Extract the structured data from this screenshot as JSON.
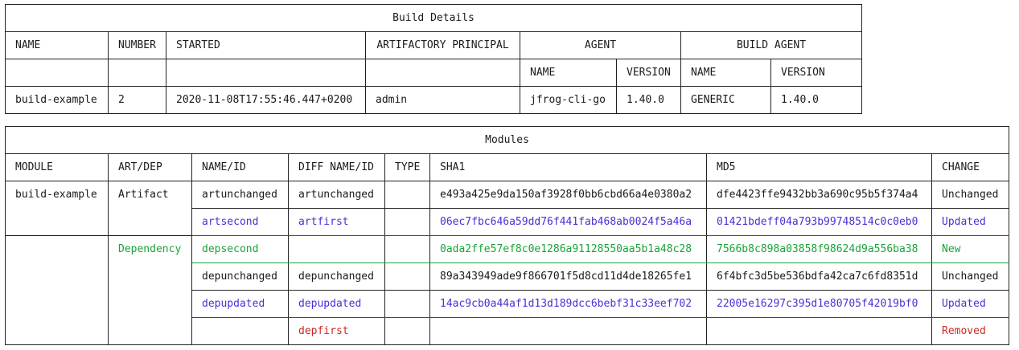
{
  "build": {
    "title": "Build Details",
    "headers": {
      "name": "NAME",
      "number": "NUMBER",
      "started": "STARTED",
      "principal": "ARTIFACTORY PRINCIPAL",
      "agent": "AGENT",
      "build_agent": "BUILD AGENT",
      "agent_name": "NAME",
      "agent_version": "VERSION",
      "build_agent_name": "NAME",
      "build_agent_version": "VERSION"
    },
    "row": {
      "name": "build-example",
      "number": "2",
      "started": "2020-11-08T17:55:46.447+0200",
      "principal": "admin",
      "agent_name": "jfrog-cli-go",
      "agent_version": "1.40.0",
      "build_agent_name": "GENERIC",
      "build_agent_version": "1.40.0"
    }
  },
  "modules": {
    "title": "Modules",
    "headers": {
      "module": "MODULE",
      "artdep": "ART/DEP",
      "nameid": "NAME/ID",
      "diffnameid": "DIFF NAME/ID",
      "type": "TYPE",
      "sha1": "SHA1",
      "md5": "MD5",
      "change": "CHANGE"
    },
    "module_name": "build-example",
    "artifact_label": "Artifact",
    "dependency_label": "Dependency",
    "rows": [
      {
        "name": "artunchanged",
        "diff": "artunchanged",
        "type": "",
        "sha1": "e493a425e9da150af3928f0bb6cbd66a4e0380a2",
        "md5": "dfe4423ffe9432bb3a690c95b5f374a4",
        "change": "Unchanged"
      },
      {
        "name": "artsecond",
        "diff": "artfirst",
        "type": "",
        "sha1": "06ec7fbc646a59dd76f441fab468ab0024f5a46a",
        "md5": "01421bdeff04a793b99748514c0c0eb0",
        "change": "Updated"
      },
      {
        "name": "depsecond",
        "diff": "",
        "type": "",
        "sha1": "0ada2ffe57ef8c0e1286a91128550aa5b1a48c28",
        "md5": "7566b8c898a03858f98624d9a556ba38",
        "change": "New"
      },
      {
        "name": "depunchanged",
        "diff": "depunchanged",
        "type": "",
        "sha1": "89a343949ade9f866701f5d8cd11d4de18265fe1",
        "md5": "6f4bfc3d5be536bdfa42ca7c6fd8351d",
        "change": "Unchanged"
      },
      {
        "name": "depupdated",
        "diff": "depupdated",
        "type": "",
        "sha1": "14ac9cb0a44af1d13d189dcc6bebf31c33eef702",
        "md5": "22005e16297c395d1e80705f42019bf0",
        "change": "Updated"
      },
      {
        "name": "",
        "diff": "depfirst",
        "type": "",
        "sha1": "",
        "md5": "",
        "change": "Removed"
      }
    ]
  },
  "colors": {
    "updated": "#4b2fd6",
    "new": "#1aa33a",
    "removed": "#cc2a22",
    "border": "#222222"
  }
}
